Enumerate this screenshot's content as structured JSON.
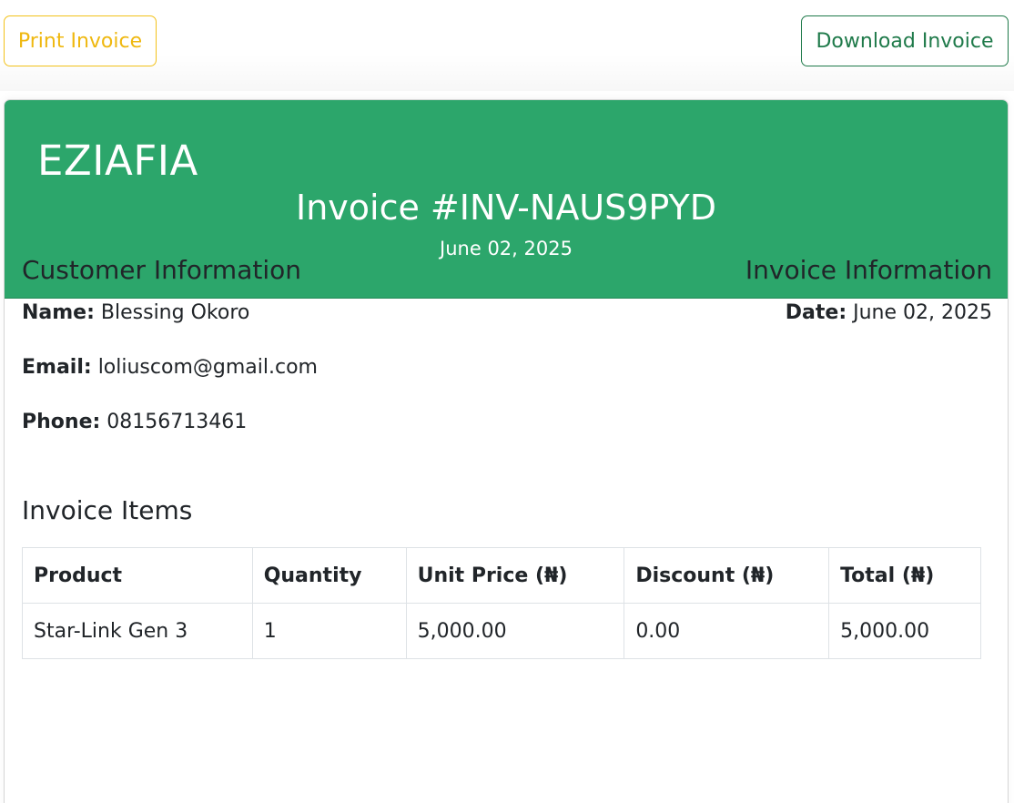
{
  "actions": {
    "print_label": "Print Invoice",
    "download_label": "Download Invoice"
  },
  "header": {
    "brand": "EZIAFIA",
    "invoice_title": "Invoice #INV-NAUS9PYD",
    "date": "June 02, 2025"
  },
  "customer": {
    "heading": "Customer Information",
    "name_label": "Name:",
    "name": "Blessing Okoro",
    "email_label": "Email:",
    "email": "loliuscom@gmail.com",
    "phone_label": "Phone:",
    "phone": "08156713461"
  },
  "invoice_info": {
    "heading": "Invoice Information",
    "date_label": "Date:",
    "date": "June 02, 2025"
  },
  "items": {
    "heading": "Invoice Items",
    "columns": [
      "Product",
      "Quantity",
      "Unit Price (₦)",
      "Discount (₦)",
      "Total (₦)"
    ],
    "rows": [
      [
        "Star-Link Gen 3",
        "1",
        "5,000.00",
        "0.00",
        "5,000.00"
      ]
    ]
  },
  "colors": {
    "header_bg": "#2ca66b",
    "print_accent": "#efb810",
    "download_accent": "#1f7a4a"
  }
}
